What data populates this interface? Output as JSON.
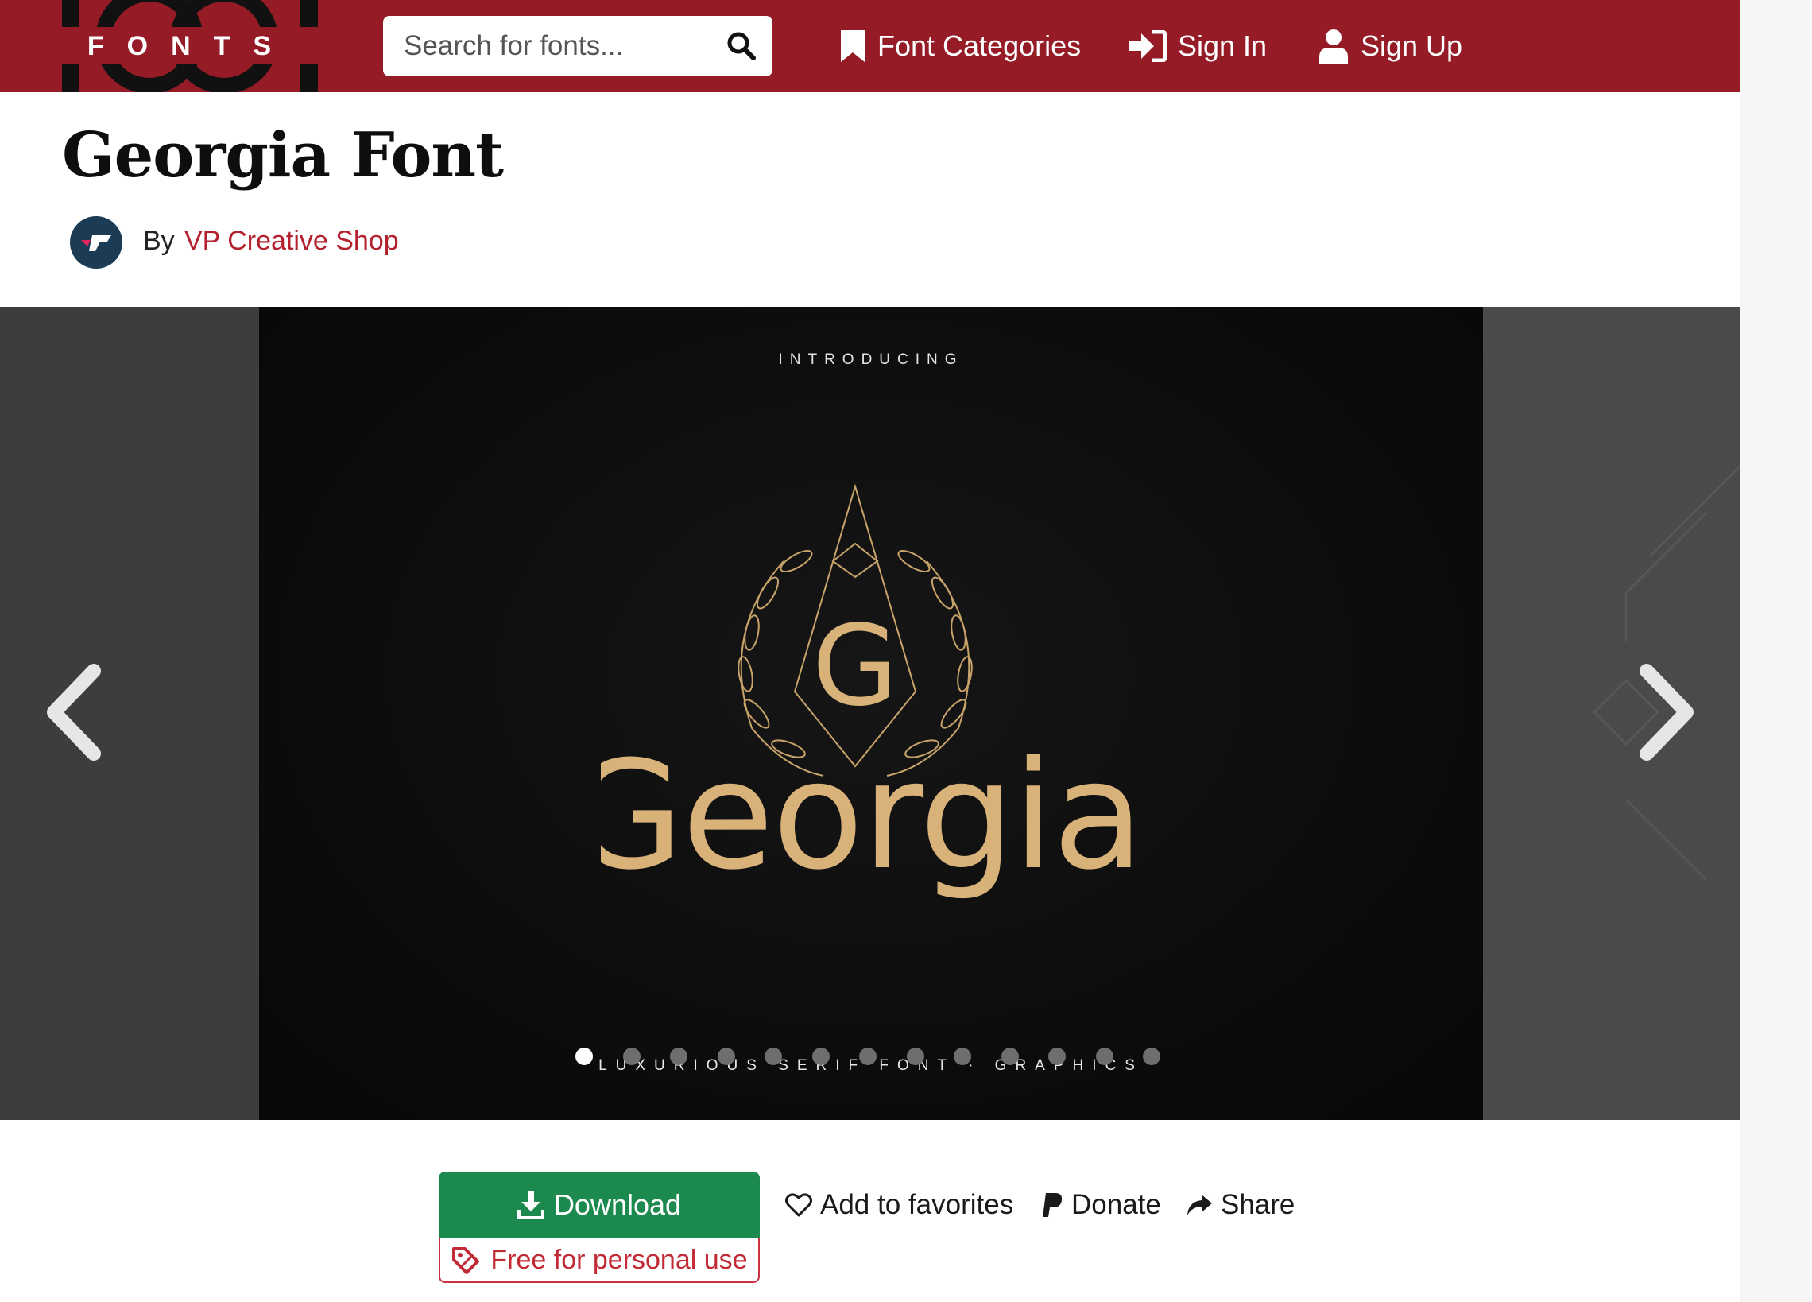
{
  "header": {
    "logo_text": "FONTS",
    "search": {
      "placeholder": "Search for fonts..."
    },
    "nav": [
      {
        "label": "Font Categories",
        "icon": "bookmark-icon"
      },
      {
        "label": "Sign In",
        "icon": "sign-in-icon"
      },
      {
        "label": "Sign Up",
        "icon": "user-icon"
      }
    ]
  },
  "page": {
    "title": "Georgia Font",
    "author_prefix": "By",
    "author_name": "VP Creative Shop"
  },
  "carousel": {
    "slide_introducing": "INTRODUCING",
    "slide_monogram": "G",
    "slide_wordmark": "Georgia",
    "slide_subtitle": "LUXURIOUS SERIF FONT · GRAPHICS",
    "dot_count": 13,
    "active_dot": 0,
    "prev_icon": "chevron-left-icon",
    "next_icon": "chevron-right-icon"
  },
  "actions": {
    "download_label": "Download",
    "license_label": "Free for personal use",
    "favorites_label": "Add to favorites",
    "donate_label": "Donate",
    "share_label": "Share"
  },
  "colors": {
    "brand": "#951b26",
    "download": "#1c8a4f",
    "link": "#b3212e",
    "gold": "#d9b27a"
  }
}
